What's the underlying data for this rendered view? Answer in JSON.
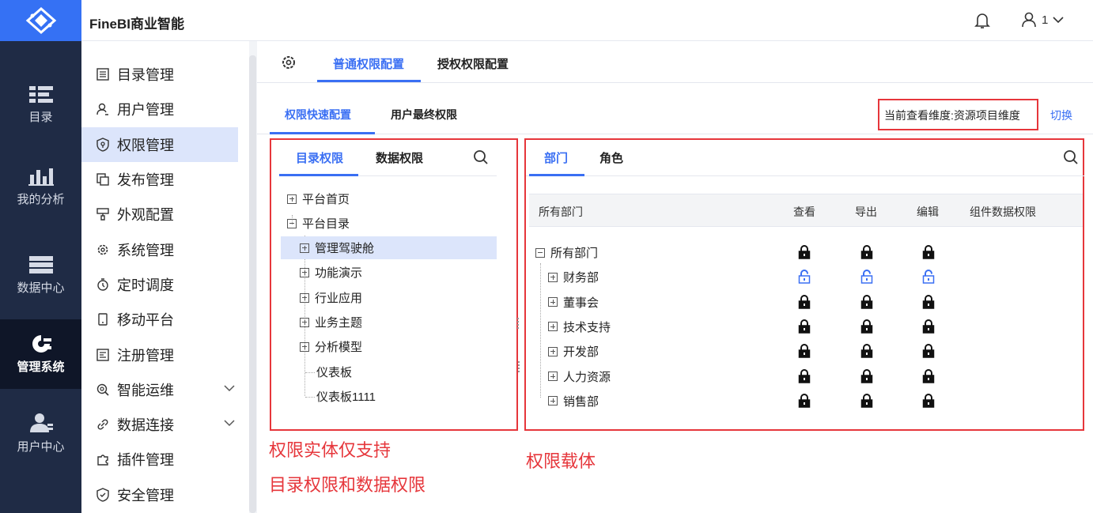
{
  "brand": {
    "title": "FineBI商业智能",
    "accent": "#3a6ff3",
    "annotation_color": "#e6363b"
  },
  "header": {
    "user_label": "1"
  },
  "rail": [
    {
      "label": "目录",
      "icon": "catalog-icon"
    },
    {
      "label": "我的分析",
      "icon": "analysis-icon"
    },
    {
      "label": "数据中心",
      "icon": "data-center-icon"
    },
    {
      "label": "管理系统",
      "icon": "admin-icon",
      "active": true
    },
    {
      "label": "用户中心",
      "icon": "user-center-icon"
    }
  ],
  "menu": [
    {
      "label": "目录管理",
      "icon": "list-icon"
    },
    {
      "label": "用户管理",
      "icon": "user-icon"
    },
    {
      "label": "权限管理",
      "icon": "shield-icon",
      "active": true
    },
    {
      "label": "发布管理",
      "icon": "publish-icon"
    },
    {
      "label": "外观配置",
      "icon": "brush-icon"
    },
    {
      "label": "系统管理",
      "icon": "gear-icon"
    },
    {
      "label": "定时调度",
      "icon": "timer-icon"
    },
    {
      "label": "移动平台",
      "icon": "phone-icon"
    },
    {
      "label": "注册管理",
      "icon": "register-icon"
    },
    {
      "label": "智能运维",
      "icon": "ops-icon",
      "expandable": true
    },
    {
      "label": "数据连接",
      "icon": "link-icon",
      "expandable": true
    },
    {
      "label": "插件管理",
      "icon": "plugin-icon"
    },
    {
      "label": "安全管理",
      "icon": "security-icon"
    }
  ],
  "main": {
    "top_tabs": [
      "普通权限配置",
      "授权权限配置"
    ],
    "sub_tabs": [
      "权限快速配置",
      "用户最终权限"
    ],
    "dimension_label": "当前查看维度:资源项目维度",
    "switch_label": "切换"
  },
  "left_panel": {
    "tabs": [
      "目录权限",
      "数据权限"
    ],
    "tree": [
      {
        "label": "平台首页",
        "toggle": "plus",
        "level": 0
      },
      {
        "label": "平台目录",
        "toggle": "minus",
        "level": 0
      },
      {
        "label": "管理驾驶舱",
        "toggle": "plus",
        "level": 1,
        "selected": true
      },
      {
        "label": "功能演示",
        "toggle": "plus",
        "level": 1
      },
      {
        "label": "行业应用",
        "toggle": "plus",
        "level": 1
      },
      {
        "label": "业务主题",
        "toggle": "plus",
        "level": 1
      },
      {
        "label": "分析模型",
        "toggle": "plus",
        "level": 1
      },
      {
        "label": "仪表板",
        "toggle": "none",
        "level": 1
      },
      {
        "label": "仪表板1111",
        "toggle": "none",
        "level": 1
      }
    ]
  },
  "right_panel": {
    "tabs": [
      "部门",
      "角色"
    ],
    "columns": [
      "所有部门",
      "查看",
      "导出",
      "编辑",
      "组件数据权限"
    ],
    "rows": [
      {
        "label": "所有部门",
        "toggle": "minus",
        "level": 0,
        "locks": [
          "locked",
          "locked",
          "locked"
        ]
      },
      {
        "label": "财务部",
        "toggle": "plus",
        "level": 1,
        "locks": [
          "unlocked",
          "unlocked",
          "unlocked"
        ]
      },
      {
        "label": "董事会",
        "toggle": "plus",
        "level": 1,
        "locks": [
          "locked",
          "locked",
          "locked"
        ]
      },
      {
        "label": "技术支持",
        "toggle": "plus",
        "level": 1,
        "locks": [
          "locked",
          "locked",
          "locked"
        ]
      },
      {
        "label": "开发部",
        "toggle": "plus",
        "level": 1,
        "locks": [
          "locked",
          "locked",
          "locked"
        ]
      },
      {
        "label": "人力资源",
        "toggle": "plus",
        "level": 1,
        "locks": [
          "locked",
          "locked",
          "locked"
        ]
      },
      {
        "label": "销售部",
        "toggle": "plus",
        "level": 1,
        "locks": [
          "locked",
          "locked",
          "locked"
        ]
      }
    ]
  },
  "annotations": {
    "left_line1": "权限实体仅支持",
    "left_line2": "目录权限和数据权限",
    "right": "权限载体"
  }
}
